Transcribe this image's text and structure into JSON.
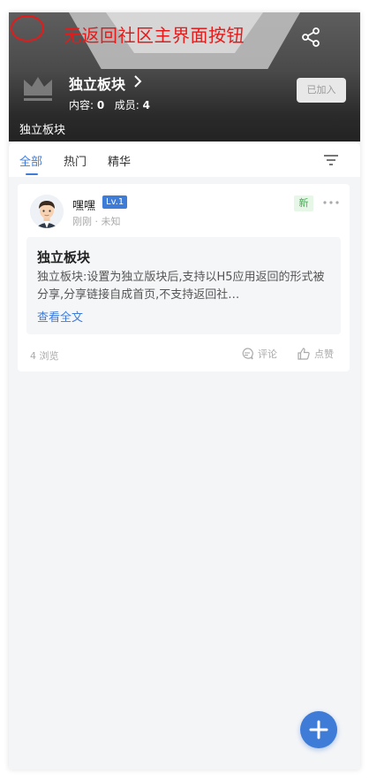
{
  "annotation": {
    "text": "无返回社区主界面按钮"
  },
  "header": {
    "board_name": "独立板块",
    "content_label": "内容:",
    "content_count": "0",
    "members_label": "成员:",
    "members_count": "4",
    "joined_label": "已加入",
    "subtitle": "独立板块",
    "icons": {
      "share": "share-icon",
      "chevron": "chevron-right-icon",
      "logo": "crown-icon"
    }
  },
  "tabs": [
    {
      "label": "全部",
      "active": true
    },
    {
      "label": "热门",
      "active": false
    },
    {
      "label": "精华",
      "active": false
    }
  ],
  "post": {
    "author": "嘿嘿",
    "level": "Lv.1",
    "meta": "刚刚 · 未知",
    "new_label": "新",
    "title": "独立板块",
    "excerpt": "独立板块:设置为独立版块后,支持以H5应用返回的形式被分享,分享链接自成首页,不支持返回社…",
    "read_more": "查看全文",
    "views": "4 浏览",
    "comment_label": "评论",
    "like_label": "点赞"
  },
  "colors": {
    "accent": "#3f7cd7",
    "annotation": "#e31b1b",
    "new_badge": "#3bb54a"
  }
}
